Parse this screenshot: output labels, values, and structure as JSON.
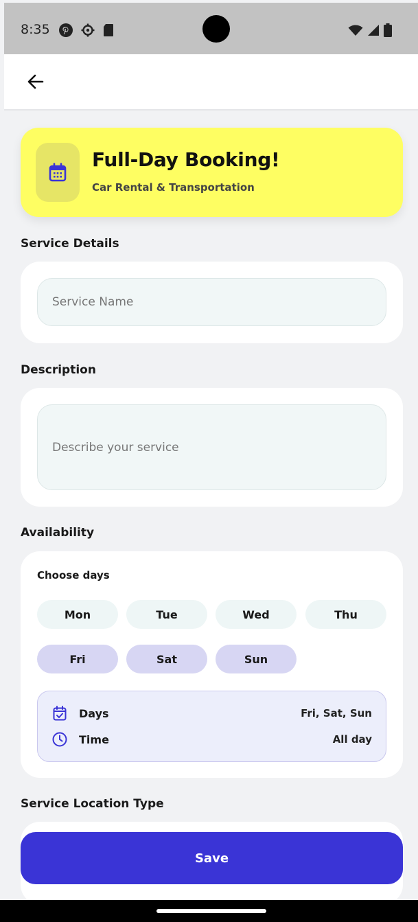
{
  "status_bar": {
    "time": "8:35",
    "icons_left": [
      "pinterest-icon",
      "settings-icon",
      "sd-card-icon"
    ],
    "icons_right": [
      "wifi-icon",
      "signal-icon",
      "battery-icon"
    ]
  },
  "app_bar": {
    "back_icon": "arrow-left-icon"
  },
  "hero": {
    "icon": "calendar-icon",
    "title": "Full-Day Booking!",
    "subtitle": "Car Rental & Transportation",
    "bg_color": "#fefe62"
  },
  "service_details": {
    "label": "Service Details",
    "name_placeholder": "Service Name",
    "name_value": ""
  },
  "description": {
    "label": "Description",
    "placeholder": "Describe your service",
    "value": ""
  },
  "availability": {
    "label": "Availability",
    "choose_days_label": "Choose days",
    "days": [
      {
        "label": "Mon",
        "selected": false
      },
      {
        "label": "Tue",
        "selected": false
      },
      {
        "label": "Wed",
        "selected": false
      },
      {
        "label": "Thu",
        "selected": false
      },
      {
        "label": "Fri",
        "selected": true
      },
      {
        "label": "Sat",
        "selected": true
      },
      {
        "label": "Sun",
        "selected": true
      }
    ],
    "summary": {
      "days_label": "Days",
      "days_value": "Fri, Sat, Sun",
      "time_label": "Time",
      "time_value": "All day"
    }
  },
  "location": {
    "label": "Service Location Type"
  },
  "save_button": {
    "label": "Save",
    "color": "#3a34d6"
  },
  "colors": {
    "accent": "#3a34d6",
    "selected_day": "#d7d6f3",
    "summary_bg": "#eceefb"
  }
}
